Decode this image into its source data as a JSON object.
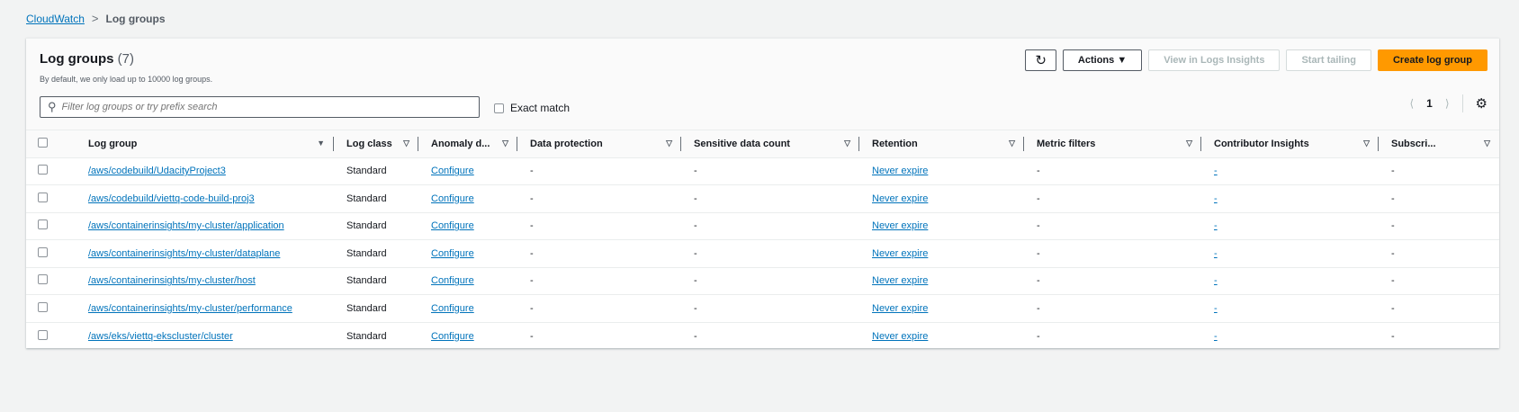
{
  "breadcrumb": {
    "parent": "CloudWatch",
    "current": "Log groups"
  },
  "header": {
    "title": "Log groups",
    "count": "(7)",
    "subtitle": "By default, we only load up to 10000 log groups."
  },
  "toolbar": {
    "actions": "Actions ▼",
    "view_insights": "View in Logs Insights",
    "start_tailing": "Start tailing",
    "create": "Create log group"
  },
  "search": {
    "placeholder": "Filter log groups or try prefix search",
    "value": "",
    "exact_match": "Exact match"
  },
  "pagination": {
    "page": "1"
  },
  "columns": [
    "Log group",
    "Log class",
    "Anomaly d...",
    "Data protection",
    "Sensitive data count",
    "Retention",
    "Metric filters",
    "Contributor Insights",
    "Subscri..."
  ],
  "rows": [
    {
      "name": "/aws/codebuild/UdacityProject3",
      "cls": "Standard",
      "anomaly": "Configure",
      "dp": "-",
      "sdc": "-",
      "ret": "Never expire",
      "mf": "-",
      "ci": "-",
      "sub": "-"
    },
    {
      "name": "/aws/codebuild/viettq-code-build-proj3",
      "cls": "Standard",
      "anomaly": "Configure",
      "dp": "-",
      "sdc": "-",
      "ret": "Never expire",
      "mf": "-",
      "ci": "-",
      "sub": "-"
    },
    {
      "name": "/aws/containerinsights/my-cluster/application",
      "cls": "Standard",
      "anomaly": "Configure",
      "dp": "-",
      "sdc": "-",
      "ret": "Never expire",
      "mf": "-",
      "ci": "-",
      "sub": "-"
    },
    {
      "name": "/aws/containerinsights/my-cluster/dataplane",
      "cls": "Standard",
      "anomaly": "Configure",
      "dp": "-",
      "sdc": "-",
      "ret": "Never expire",
      "mf": "-",
      "ci": "-",
      "sub": "-"
    },
    {
      "name": "/aws/containerinsights/my-cluster/host",
      "cls": "Standard",
      "anomaly": "Configure",
      "dp": "-",
      "sdc": "-",
      "ret": "Never expire",
      "mf": "-",
      "ci": "-",
      "sub": "-"
    },
    {
      "name": "/aws/containerinsights/my-cluster/performance",
      "cls": "Standard",
      "anomaly": "Configure",
      "dp": "-",
      "sdc": "-",
      "ret": "Never expire",
      "mf": "-",
      "ci": "-",
      "sub": "-"
    },
    {
      "name": "/aws/eks/viettq-ekscluster/cluster",
      "cls": "Standard",
      "anomaly": "Configure",
      "dp": "-",
      "sdc": "-",
      "ret": "Never expire",
      "mf": "-",
      "ci": "-",
      "sub": "-"
    }
  ]
}
